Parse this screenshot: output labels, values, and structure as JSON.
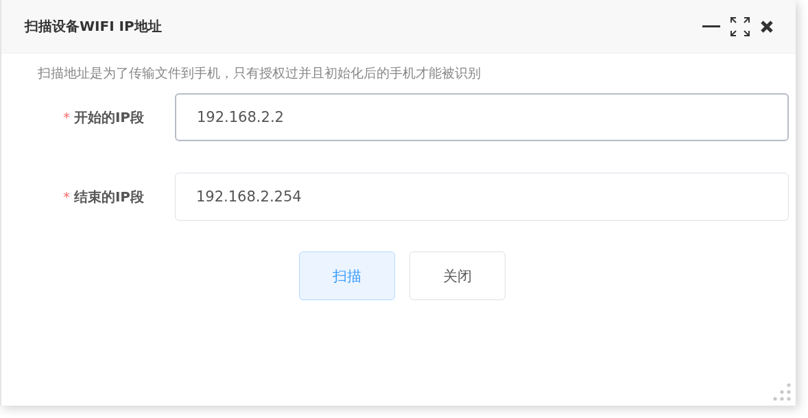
{
  "window": {
    "title": "扫描设备WIFI IP地址"
  },
  "description": "扫描地址是为了传输文件到手机，只有授权过并且初始化后的手机才能被识别",
  "fields": [
    {
      "required_mark": "*",
      "label": "开始的IP段",
      "value": "192.168.2.2",
      "focused": true
    },
    {
      "required_mark": "*",
      "label": "结束的IP段",
      "value": "192.168.2.254",
      "focused": false
    }
  ],
  "buttons": [
    {
      "label": "扫描",
      "kind": "primary"
    },
    {
      "label": "关闭",
      "kind": "default"
    }
  ]
}
